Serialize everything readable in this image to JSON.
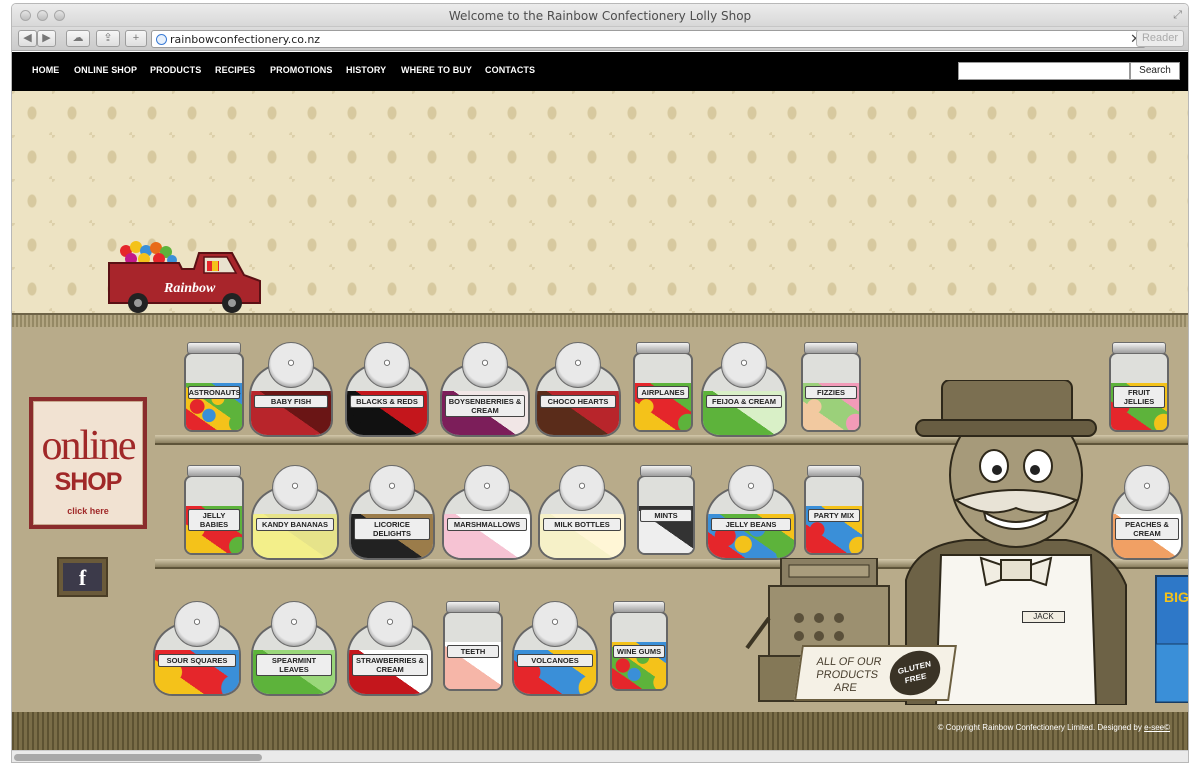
{
  "browser": {
    "window_title": "Welcome to the Rainbow Confectionery Lolly Shop",
    "url": "rainbowconfectionery.co.nz",
    "reader_label": "Reader",
    "back_icon": "back-arrow-icon",
    "forward_icon": "forward-arrow-icon"
  },
  "nav": {
    "items": [
      "HOME",
      "ONLINE SHOP",
      "PRODUCTS",
      "RECIPES",
      "PROMOTIONS",
      "HISTORY",
      "WHERE TO BUY",
      "CONTACTS"
    ],
    "search_placeholder": "",
    "search_button": "Search"
  },
  "truck": {
    "brand": "Rainbow"
  },
  "online_shop": {
    "line1": "online",
    "line2": "SHOP",
    "line3": "click here"
  },
  "facebook": {
    "letter": "f"
  },
  "jars": {
    "row1": [
      "ASTRONAUTS",
      "BABY FISH",
      "BLACKS & REDS",
      "BOYSENBERRIES & CREAM",
      "CHOCO HEARTS",
      "AIRPLANES",
      "FEIJOA & CREAM",
      "FIZZIES",
      "FRUIT JELLIES"
    ],
    "row2": [
      "JELLY BABIES",
      "KANDY BANANAS",
      "LICORICE DELIGHTS",
      "MARSHMALLOWS",
      "MILK BOTTLES",
      "MINTS",
      "JELLY BEANS",
      "PARTY MIX",
      "PEACHES & CREAM"
    ],
    "row3": [
      "SOUR SQUARES",
      "SPEARMINT LEAVES",
      "STRAWBERRIES & CREAM",
      "TEETH",
      "VOLCANOES",
      "WINE GUMS"
    ]
  },
  "shopkeeper": {
    "name_tag": "JACK"
  },
  "counter_sign": {
    "text": "ALL OF OUR PRODUCTS ARE",
    "badge": "GLUTEN FREE"
  },
  "box": {
    "label": "BIG"
  },
  "footer": {
    "copyright": "© Copyright Rainbow Confectionery Limited. Designed by ",
    "designer": "e-see©"
  },
  "colors": {
    "nav_bg": "#000000",
    "wall": "#ede3c3",
    "shop_bg": "#b8ab8a",
    "online_red": "#a02828"
  }
}
